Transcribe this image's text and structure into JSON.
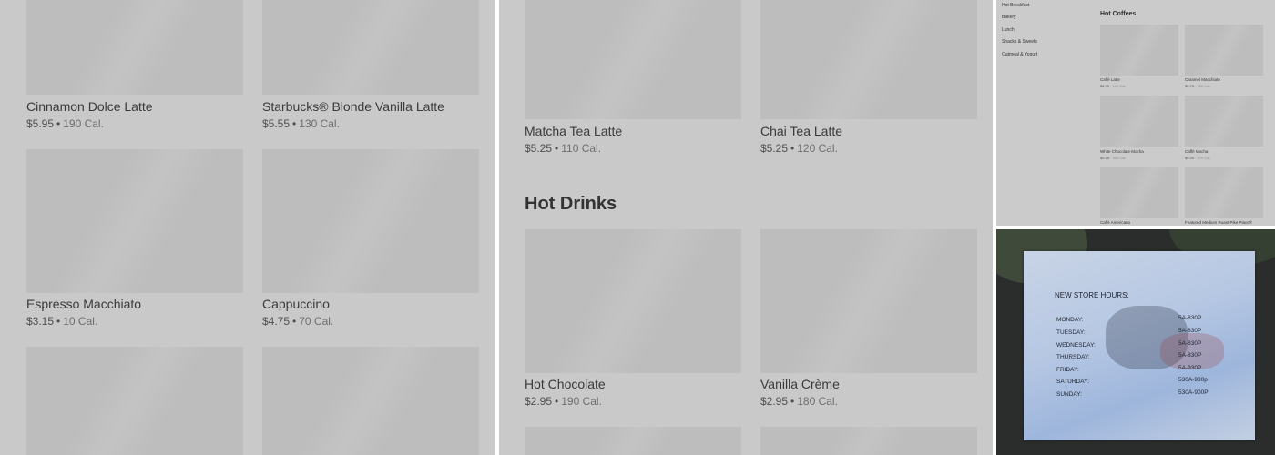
{
  "panel_a": {
    "products": [
      {
        "name": "Cinnamon Dolce Latte",
        "price": "$5.95",
        "cal": "190 Cal."
      },
      {
        "name": "Starbucks® Blonde Vanilla Latte",
        "price": "$5.55",
        "cal": "130 Cal."
      },
      {
        "name": "Espresso Macchiato",
        "price": "$3.15",
        "cal": "10 Cal."
      },
      {
        "name": "Cappuccino",
        "price": "$4.75",
        "cal": "70 Cal."
      }
    ]
  },
  "panel_b": {
    "products_top": [
      {
        "name": "Matcha Tea Latte",
        "price": "$5.25",
        "cal": "110 Cal."
      },
      {
        "name": "Chai Tea Latte",
        "price": "$5.25",
        "cal": "120 Cal."
      }
    ],
    "section_title": "Hot Drinks",
    "products": [
      {
        "name": "Hot Chocolate",
        "price": "$2.95",
        "cal": "190 Cal."
      },
      {
        "name": "Vanilla Crème",
        "price": "$2.95",
        "cal": "180 Cal."
      }
    ]
  },
  "panel_c": {
    "nav": [
      "Hot Breakfast",
      "Bakery",
      "Lunch",
      "Snacks & Sweets",
      "Oatmeal & Yogurt"
    ],
    "section_title": "Hot Coffees",
    "products": [
      {
        "name": "Caffè Latte",
        "price": "$4.75",
        "cal": "190 Cal."
      },
      {
        "name": "Caramel Macchiato",
        "price": "$5.75",
        "cal": "250 Cal."
      },
      {
        "name": "White Chocolate Mocha",
        "price": "$5.95",
        "cal": "430 Cal."
      },
      {
        "name": "Caffè Mocha",
        "price": "$5.45",
        "cal": "370 Cal."
      },
      {
        "name": "Caffè Americano",
        "price": "",
        "cal": ""
      },
      {
        "name": "Featured Medium Roast Pike Place®",
        "price": "",
        "cal": ""
      }
    ]
  },
  "panel_d": {
    "title": "NEW STORE HOURS:",
    "hours": [
      {
        "day": "MONDAY:",
        "time": "5A-830P"
      },
      {
        "day": "TUESDAY:",
        "time": "5A-830P"
      },
      {
        "day": "WEDNESDAY:",
        "time": "5A-830P"
      },
      {
        "day": "THURSDAY:",
        "time": "5A-830P"
      },
      {
        "day": "FRIDAY:",
        "time": "5A-930P"
      },
      {
        "day": "SATURDAY:",
        "time": "530A-930p"
      },
      {
        "day": "SUNDAY:",
        "time": "530A-900P"
      }
    ]
  }
}
